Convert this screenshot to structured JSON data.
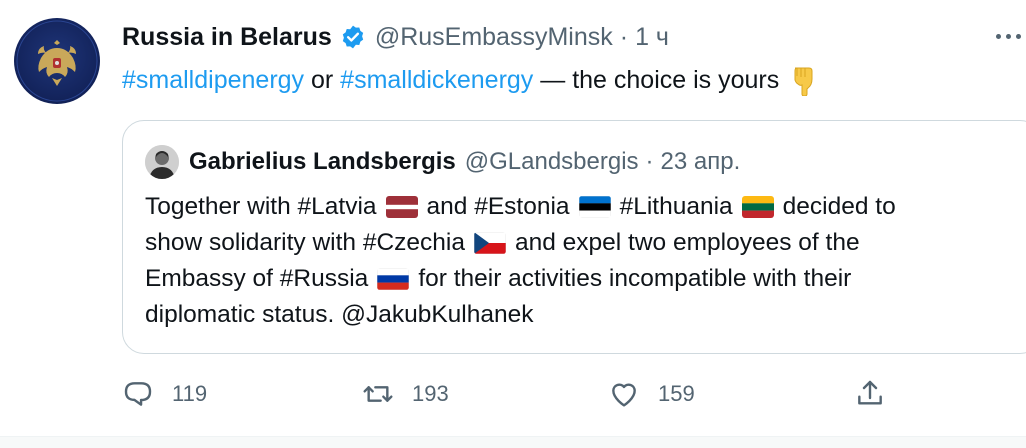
{
  "tweet": {
    "author": {
      "display_name": "Russia in Belarus",
      "handle": "@RusEmbassyMinsk",
      "separator": "·",
      "time": "1 ч",
      "verified": true
    },
    "text": {
      "hashtag1": "#smalldipenergy",
      "connector": " or ",
      "hashtag2": "#smalldickenergy",
      "rest": " — the choice is yours",
      "emoji": "pointing-down-hand-emoji"
    },
    "quote": {
      "author": {
        "display_name": "Gabrielius Landsbergis",
        "handle": "@GLandsbergis",
        "separator": "·",
        "time": "23 апр."
      },
      "lines": [
        {
          "a": "Together with #Latvia",
          "b": "and #Estonia",
          "c": "#Lithuania",
          "d": "decided to"
        },
        {
          "a": "show solidarity with #Czechia",
          "b": "and expel two employees of the"
        },
        {
          "a": "Embassy of #Russia",
          "b": "for their activities incompatible with their"
        },
        {
          "a": "diplomatic status. @JakubKulhanek"
        }
      ],
      "flags": [
        "latvia-flag",
        "estonia-flag",
        "lithuania-flag",
        "czechia-flag",
        "russia-flag"
      ]
    },
    "actions": {
      "reply_count": "119",
      "retweet_count": "193",
      "like_count": "159"
    }
  },
  "colors": {
    "link": "#1d9bf0",
    "text": "#0f1419",
    "secondary": "#536471",
    "border": "#cfd9de",
    "verified": "#1d9bf0"
  }
}
